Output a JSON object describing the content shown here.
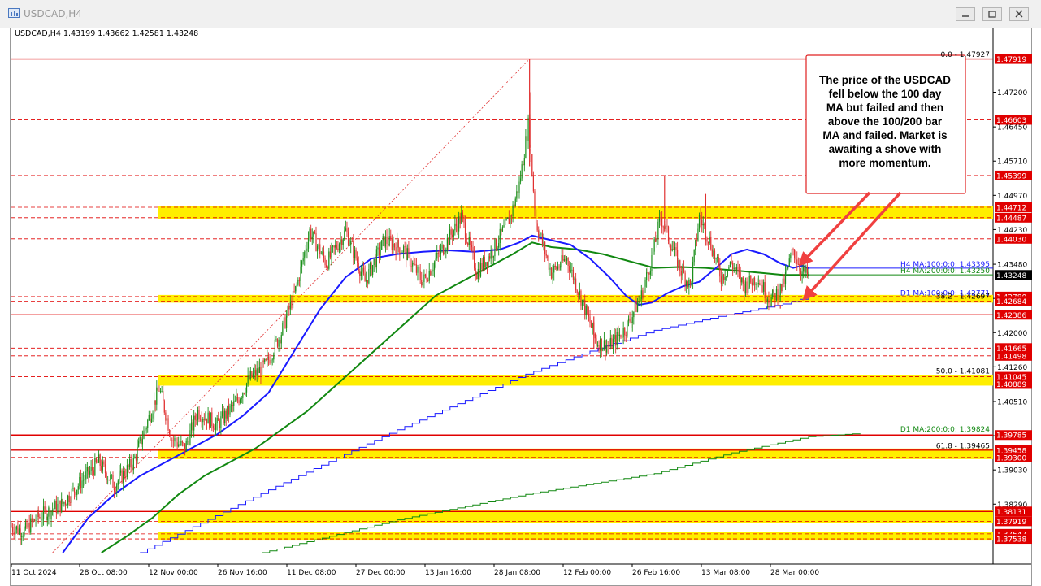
{
  "window": {
    "title": "USDCAD,H4",
    "icons": [
      "chart-app-icon",
      "minimize-icon",
      "maximize-icon",
      "close-icon"
    ]
  },
  "chart_data": {
    "type": "candlestick",
    "symbol_info": "USDCAD,H4  1.43199 1.43662 1.42581 1.43248",
    "ylim": [
      1.3724,
      1.4807
    ],
    "current_price": "1.43248",
    "x_ticks": [
      "11 Oct 2024",
      "28 Oct 08:00",
      "12 Nov 00:00",
      "26 Nov 16:00",
      "11 Dec 08:00",
      "27 Dec 00:00",
      "13 Jan 16:00",
      "28 Jan 08:00",
      "12 Feb 00:00",
      "26 Feb 16:00",
      "13 Mar 08:00",
      "28 Mar 00:00"
    ],
    "y_ticks": [
      "1.47200",
      "1.46450",
      "1.45710",
      "1.44970",
      "1.44230",
      "1.43480",
      "1.42740",
      "1.42000",
      "1.41260",
      "1.40510",
      "1.39770",
      "1.39030",
      "1.38290"
    ],
    "levels": [
      {
        "label": "1.47919",
        "value": 1.47919,
        "style": "red"
      },
      {
        "label": "1.46603",
        "value": 1.46603,
        "style": "red"
      },
      {
        "label": "1.45399",
        "value": 1.45399,
        "style": "red"
      },
      {
        "label": "1.44712",
        "value": 1.44712,
        "style": "red"
      },
      {
        "label": "1.44487",
        "value": 1.44487,
        "style": "red"
      },
      {
        "label": "1.44030",
        "value": 1.4403,
        "style": "red"
      },
      {
        "label": "1.42780",
        "value": 1.4278,
        "style": "red"
      },
      {
        "label": "1.42684",
        "value": 1.42684,
        "style": "red"
      },
      {
        "label": "1.42386",
        "value": 1.42386,
        "style": "red"
      },
      {
        "label": "1.41665",
        "value": 1.41665,
        "style": "red"
      },
      {
        "label": "1.41498",
        "value": 1.41498,
        "style": "red"
      },
      {
        "label": "1.41045",
        "value": 1.41045,
        "style": "red"
      },
      {
        "label": "1.40889",
        "value": 1.40889,
        "style": "red"
      },
      {
        "label": "1.39785",
        "value": 1.39785,
        "style": "red"
      },
      {
        "label": "1.39458",
        "value": 1.39458,
        "style": "red"
      },
      {
        "label": "1.39300",
        "value": 1.393,
        "style": "red"
      },
      {
        "label": "1.38131",
        "value": 1.38131,
        "style": "red"
      },
      {
        "label": "1.37919",
        "value": 1.37919,
        "style": "red"
      },
      {
        "label": "1.37647",
        "value": 1.37647,
        "style": "red"
      },
      {
        "label": "1.37538",
        "value": 1.37538,
        "style": "red"
      }
    ],
    "zones": [
      {
        "from": 1.44487,
        "to": 1.44712
      },
      {
        "from": 1.42684,
        "to": 1.4278
      },
      {
        "from": 1.40889,
        "to": 1.41045
      },
      {
        "from": 1.393,
        "to": 1.39458
      },
      {
        "from": 1.37919,
        "to": 1.38131
      },
      {
        "from": 1.37538,
        "to": 1.37647
      }
    ],
    "fib_labels": [
      {
        "text": "0.0 - 1.47927",
        "value": 1.47927
      },
      {
        "text": "38.2 - 1.42697",
        "value": 1.42697
      },
      {
        "text": "50.0 - 1.41081",
        "value": 1.41081
      },
      {
        "text": "61.8 - 1.39465",
        "value": 1.39465
      }
    ],
    "ma_labels": [
      {
        "text": "H4 MA:100:0:0: 1.43395",
        "value": 1.43395,
        "color": "#1a1aff"
      },
      {
        "text": "H4 MA:200:0:0: 1.43250",
        "value": 1.4325,
        "color": "#118811"
      },
      {
        "text": "D1 MA:100:0:0: 1.42771",
        "value": 1.42771,
        "color": "#1a1aff"
      },
      {
        "text": "D1 MA:200:0:0: 1.39824",
        "value": 1.39824,
        "color": "#118811"
      }
    ],
    "annotation": [
      "The price of the USDCAD",
      "fell below the 100 day",
      "MA but failed and then",
      "above the 100/200 bar",
      "MA and failed.  Market is",
      "awaiting a shove with",
      "more momentum."
    ],
    "colors": {
      "bull": "#1a8f1a",
      "bear": "#e03030",
      "level": "#e00000",
      "zone": "#ffee00",
      "h4_ma100": "#1a1aff",
      "h4_ma200": "#118811",
      "d1_ma100": "#1a1aff",
      "d1_ma200": "#118811",
      "annotation_border": "#e02020"
    },
    "price_path": [
      {
        "i": 0,
        "p": 1.378
      },
      {
        "i": 10,
        "p": 1.377
      },
      {
        "i": 20,
        "p": 1.38
      },
      {
        "i": 40,
        "p": 1.383
      },
      {
        "i": 55,
        "p": 1.388
      },
      {
        "i": 68,
        "p": 1.392
      },
      {
        "i": 80,
        "p": 1.387
      },
      {
        "i": 95,
        "p": 1.392
      },
      {
        "i": 105,
        "p": 1.4
      },
      {
        "i": 115,
        "p": 1.408
      },
      {
        "i": 125,
        "p": 1.397
      },
      {
        "i": 135,
        "p": 1.395
      },
      {
        "i": 145,
        "p": 1.403
      },
      {
        "i": 160,
        "p": 1.4
      },
      {
        "i": 175,
        "p": 1.405
      },
      {
        "i": 185,
        "p": 1.41
      },
      {
        "i": 198,
        "p": 1.413
      },
      {
        "i": 210,
        "p": 1.42
      },
      {
        "i": 222,
        "p": 1.43
      },
      {
        "i": 232,
        "p": 1.442
      },
      {
        "i": 245,
        "p": 1.435
      },
      {
        "i": 260,
        "p": 1.442
      },
      {
        "i": 275,
        "p": 1.431
      },
      {
        "i": 290,
        "p": 1.44
      },
      {
        "i": 305,
        "p": 1.438
      },
      {
        "i": 320,
        "p": 1.431
      },
      {
        "i": 335,
        "p": 1.438
      },
      {
        "i": 350,
        "p": 1.445
      },
      {
        "i": 362,
        "p": 1.433
      },
      {
        "i": 375,
        "p": 1.438
      },
      {
        "i": 388,
        "p": 1.445
      },
      {
        "i": 395,
        "p": 1.452
      },
      {
        "i": 402,
        "p": 1.465
      },
      {
        "i": 408,
        "p": 1.444
      },
      {
        "i": 420,
        "p": 1.433
      },
      {
        "i": 432,
        "p": 1.436
      },
      {
        "i": 445,
        "p": 1.426
      },
      {
        "i": 455,
        "p": 1.418
      },
      {
        "i": 465,
        "p": 1.417
      },
      {
        "i": 478,
        "p": 1.421
      },
      {
        "i": 490,
        "p": 1.428
      },
      {
        "i": 498,
        "p": 1.436
      },
      {
        "i": 505,
        "p": 1.445
      },
      {
        "i": 512,
        "p": 1.44
      },
      {
        "i": 520,
        "p": 1.434
      },
      {
        "i": 528,
        "p": 1.43
      },
      {
        "i": 535,
        "p": 1.445
      },
      {
        "i": 543,
        "p": 1.44
      },
      {
        "i": 552,
        "p": 1.432
      },
      {
        "i": 560,
        "p": 1.435
      },
      {
        "i": 570,
        "p": 1.43
      },
      {
        "i": 580,
        "p": 1.432
      },
      {
        "i": 590,
        "p": 1.427
      },
      {
        "i": 600,
        "p": 1.43
      },
      {
        "i": 608,
        "p": 1.438
      },
      {
        "i": 615,
        "p": 1.433
      },
      {
        "i": 620,
        "p": 1.4325
      }
    ],
    "price_spikes": [
      {
        "i": 403,
        "high": 1.47919,
        "low": 1.456
      },
      {
        "i": 404,
        "high": 1.472,
        "low": 1.46
      },
      {
        "i": 453,
        "high": 1.4235,
        "low": 1.4165
      },
      {
        "i": 508,
        "high": 1.4539,
        "low": 1.442
      },
      {
        "i": 540,
        "high": 1.45,
        "low": 1.44
      },
      {
        "i": 598,
        "high": 1.4252,
        "low": 1.426
      }
    ],
    "ma_paths": {
      "h4_ma100": [
        {
          "i": 40,
          "p": 1.3724
        },
        {
          "i": 60,
          "p": 1.38
        },
        {
          "i": 80,
          "p": 1.385
        },
        {
          "i": 100,
          "p": 1.389
        },
        {
          "i": 120,
          "p": 1.392
        },
        {
          "i": 140,
          "p": 1.395
        },
        {
          "i": 160,
          "p": 1.398
        },
        {
          "i": 180,
          "p": 1.402
        },
        {
          "i": 200,
          "p": 1.407
        },
        {
          "i": 220,
          "p": 1.416
        },
        {
          "i": 240,
          "p": 1.425
        },
        {
          "i": 260,
          "p": 1.432
        },
        {
          "i": 280,
          "p": 1.436
        },
        {
          "i": 300,
          "p": 1.437
        },
        {
          "i": 320,
          "p": 1.4375
        },
        {
          "i": 340,
          "p": 1.4378
        },
        {
          "i": 360,
          "p": 1.4375
        },
        {
          "i": 380,
          "p": 1.438
        },
        {
          "i": 395,
          "p": 1.4395
        },
        {
          "i": 405,
          "p": 1.441
        },
        {
          "i": 420,
          "p": 1.44
        },
        {
          "i": 435,
          "p": 1.439
        },
        {
          "i": 450,
          "p": 1.436
        },
        {
          "i": 465,
          "p": 1.432
        },
        {
          "i": 478,
          "p": 1.428
        },
        {
          "i": 488,
          "p": 1.426
        },
        {
          "i": 498,
          "p": 1.4265
        },
        {
          "i": 510,
          "p": 1.4285
        },
        {
          "i": 522,
          "p": 1.43
        },
        {
          "i": 535,
          "p": 1.431
        },
        {
          "i": 548,
          "p": 1.434
        },
        {
          "i": 560,
          "p": 1.437
        },
        {
          "i": 572,
          "p": 1.438
        },
        {
          "i": 585,
          "p": 1.437
        },
        {
          "i": 598,
          "p": 1.435
        },
        {
          "i": 608,
          "p": 1.434
        },
        {
          "i": 615,
          "p": 1.4345
        },
        {
          "i": 620,
          "p": 1.4339
        }
      ],
      "h4_ma200": [
        {
          "i": 70,
          "p": 1.3724
        },
        {
          "i": 90,
          "p": 1.376
        },
        {
          "i": 110,
          "p": 1.38
        },
        {
          "i": 130,
          "p": 1.385
        },
        {
          "i": 150,
          "p": 1.389
        },
        {
          "i": 170,
          "p": 1.392
        },
        {
          "i": 190,
          "p": 1.395
        },
        {
          "i": 210,
          "p": 1.399
        },
        {
          "i": 230,
          "p": 1.403
        },
        {
          "i": 250,
          "p": 1.408
        },
        {
          "i": 270,
          "p": 1.413
        },
        {
          "i": 290,
          "p": 1.418
        },
        {
          "i": 310,
          "p": 1.423
        },
        {
          "i": 330,
          "p": 1.428
        },
        {
          "i": 350,
          "p": 1.431
        },
        {
          "i": 370,
          "p": 1.434
        },
        {
          "i": 390,
          "p": 1.437
        },
        {
          "i": 405,
          "p": 1.4395
        },
        {
          "i": 420,
          "p": 1.4385
        },
        {
          "i": 440,
          "p": 1.438
        },
        {
          "i": 460,
          "p": 1.437
        },
        {
          "i": 480,
          "p": 1.4355
        },
        {
          "i": 500,
          "p": 1.434
        },
        {
          "i": 520,
          "p": 1.4342
        },
        {
          "i": 540,
          "p": 1.434
        },
        {
          "i": 560,
          "p": 1.4335
        },
        {
          "i": 580,
          "p": 1.433
        },
        {
          "i": 600,
          "p": 1.4325
        },
        {
          "i": 620,
          "p": 1.4325
        }
      ],
      "d1_ma100": [
        {
          "i": 100,
          "p": 1.3724
        },
        {
          "i": 200,
          "p": 1.386
        },
        {
          "i": 300,
          "p": 1.399
        },
        {
          "i": 400,
          "p": 1.411
        },
        {
          "i": 450,
          "p": 1.416
        },
        {
          "i": 500,
          "p": 1.4205
        },
        {
          "i": 550,
          "p": 1.4235
        },
        {
          "i": 600,
          "p": 1.4262
        },
        {
          "i": 620,
          "p": 1.4277
        }
      ],
      "d1_ma200": [
        {
          "i": 195,
          "p": 1.3724
        },
        {
          "i": 300,
          "p": 1.3795
        },
        {
          "i": 400,
          "p": 1.385
        },
        {
          "i": 500,
          "p": 1.3895
        },
        {
          "i": 560,
          "p": 1.394
        },
        {
          "i": 620,
          "p": 1.3975
        },
        {
          "i": 660,
          "p": 1.3982
        }
      ]
    }
  }
}
